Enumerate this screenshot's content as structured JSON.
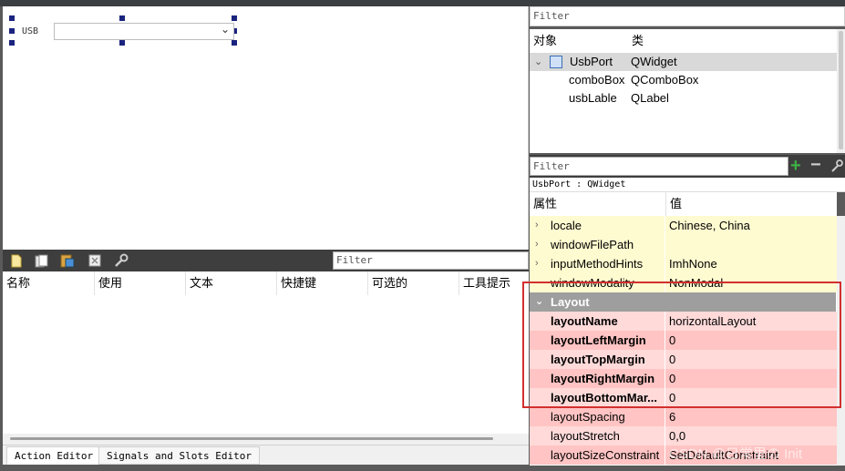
{
  "canvas": {
    "usb_label": "USB"
  },
  "action_editor": {
    "filter_placeholder": "Filter",
    "columns": [
      "名称",
      "使用",
      "文本",
      "快捷键",
      "可选的",
      "工具提示"
    ],
    "tabs": [
      "Action Editor",
      "Signals and Slots Editor"
    ]
  },
  "object_inspector": {
    "filter_placeholder": "Filter",
    "columns": [
      "对象",
      "类"
    ],
    "rows": [
      {
        "object": "UsbPort",
        "class": "QWidget"
      },
      {
        "object": "comboBox",
        "class": "QComboBox"
      },
      {
        "object": "usbLable",
        "class": "QLabel"
      }
    ]
  },
  "property_editor": {
    "filter_placeholder": "Filter",
    "object_title": "UsbPort : QWidget",
    "columns": [
      "属性",
      "值"
    ],
    "rows": [
      {
        "name": "locale",
        "value": "Chinese, China"
      },
      {
        "name": "windowFilePath",
        "value": ""
      },
      {
        "name": "inputMethodHints",
        "value": "ImhNone"
      },
      {
        "name": "windowModality",
        "value": "NonModal"
      },
      {
        "name": "Layout",
        "value": ""
      },
      {
        "name": "layoutName",
        "value": "horizontalLayout"
      },
      {
        "name": "layoutLeftMargin",
        "value": "0"
      },
      {
        "name": "layoutTopMargin",
        "value": "0"
      },
      {
        "name": "layoutRightMargin",
        "value": "0"
      },
      {
        "name": "layoutBottomMar...",
        "value": "0"
      },
      {
        "name": "layoutSpacing",
        "value": "6"
      },
      {
        "name": "layoutStretch",
        "value": "0,0"
      },
      {
        "name": "layoutSizeConstraint",
        "value": "SetDefaultConstraint"
      }
    ]
  },
  "watermark": "CSDN @日常里の Init",
  "colors": {
    "yellow_row": "#fffbd0",
    "pink_row_light": "#ffdad9",
    "pink_row_dark": "#ffc4c3",
    "section_header": "#9e9e9e",
    "highlight_box": "#d32f2f"
  }
}
